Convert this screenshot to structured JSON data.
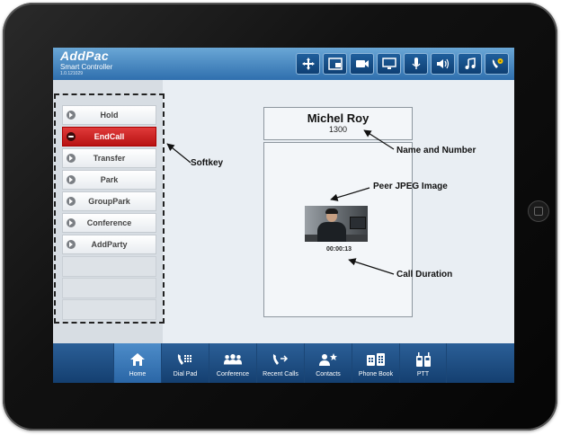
{
  "app": {
    "logo": "AddPac",
    "subtitle": "Smart Controller",
    "version": "1.0.121029"
  },
  "toolbar_icons": [
    "move-icon",
    "pip-icon",
    "video-icon",
    "monitor-icon",
    "microphone-icon",
    "speaker-icon",
    "music-icon",
    "phone-settings-icon"
  ],
  "softkeys": [
    "Hold",
    "EndCall",
    "Transfer",
    "Park",
    "GroupPark",
    "Conference",
    "AddParty"
  ],
  "call": {
    "name": "Michel Roy",
    "number": "1300",
    "duration": "00:00:13"
  },
  "nav": [
    {
      "label": "Home",
      "icon": "home-icon",
      "active": true
    },
    {
      "label": "Dial Pad",
      "icon": "dialpad-icon",
      "active": false
    },
    {
      "label": "Conference",
      "icon": "conference-icon",
      "active": false
    },
    {
      "label": "Recent Calls",
      "icon": "recent-calls-icon",
      "active": false
    },
    {
      "label": "Contacts",
      "icon": "contacts-icon",
      "active": false
    },
    {
      "label": "Phone Book",
      "icon": "phone-book-icon",
      "active": false
    },
    {
      "label": "PTT",
      "icon": "ptt-icon",
      "active": false
    }
  ],
  "annotations": {
    "softkey": "Softkey",
    "name_number": "Name and Number",
    "peer_image": "Peer JPEG Image",
    "call_duration": "Call Duration"
  },
  "colors": {
    "topbar": "#2f6fae",
    "endcall": "#c41a1a",
    "bottombar": "#143f70"
  }
}
